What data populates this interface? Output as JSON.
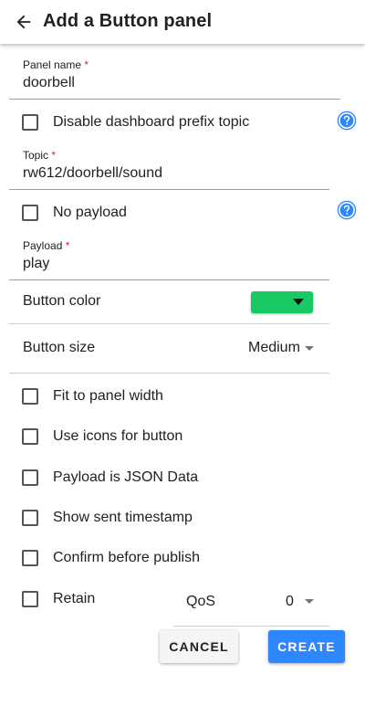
{
  "header": {
    "title": "Add a Button panel",
    "back_icon": "arrow-left-icon"
  },
  "form": {
    "panel_name": {
      "label": "Panel name",
      "required_mark": "*",
      "value": "doorbell"
    },
    "disable_prefix": {
      "label": "Disable dashboard prefix topic",
      "checked": false
    },
    "topic": {
      "label": "Topic",
      "required_mark": "*",
      "value": "rw612/doorbell/sound"
    },
    "no_payload": {
      "label": "No payload",
      "checked": false
    },
    "payload": {
      "label": "Payload",
      "required_mark": "*",
      "value": "play"
    },
    "button_color": {
      "label": "Button color",
      "color": "#19c964"
    },
    "button_size": {
      "label": "Button size",
      "value": "Medium"
    },
    "options": [
      {
        "label": "Fit to panel width",
        "checked": false
      },
      {
        "label": "Use icons for button",
        "checked": false
      },
      {
        "label": "Payload is JSON Data",
        "checked": false
      },
      {
        "label": "Show sent timestamp",
        "checked": false
      },
      {
        "label": "Confirm before publish",
        "checked": false
      }
    ],
    "retain": {
      "label": "Retain",
      "checked": false
    },
    "qos": {
      "label": "QoS",
      "value": "0"
    }
  },
  "actions": {
    "cancel_label": "CANCEL",
    "create_label": "CREATE"
  },
  "colors": {
    "accent": "#2f87ff",
    "help_icon": "#2f87ff",
    "required": "#d32f2f"
  }
}
